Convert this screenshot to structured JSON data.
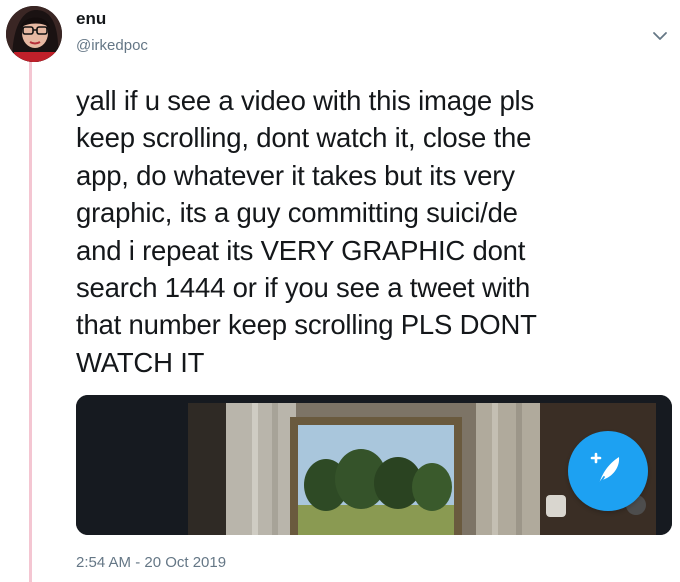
{
  "tweet": {
    "author_name": "enu",
    "author_handle": "@irkedpoc",
    "text": "yall if u see a video with this image pls\nkeep scrolling, dont watch it, close the\napp, do whatever it takes but its very\ngraphic, its a guy  committing suici/de\nand i repeat its VERY GRAPHIC dont\nsearch 1444 or if you see a tweet with\nthat number keep scrolling PLS DONT\nWATCH IT",
    "timestamp": "2:54 AM - 20 Oct 2019"
  },
  "icons": {
    "avatar": "user-avatar",
    "caret": "chevron-down-icon",
    "compose": "compose-tweet-icon"
  },
  "colors": {
    "accent": "#1da1f2",
    "thread_line": "#f4c6d2",
    "secondary_text": "#657786"
  }
}
